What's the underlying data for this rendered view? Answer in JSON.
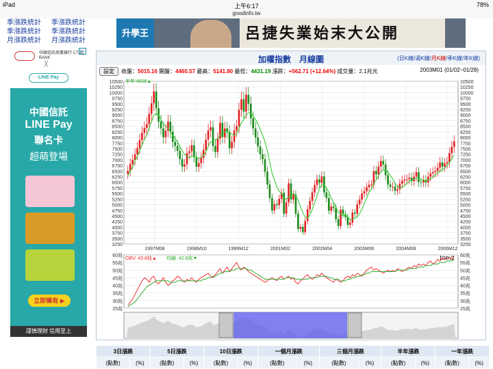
{
  "status": {
    "device": "iPad",
    "time": "上午6:17",
    "battery": "78%"
  },
  "url": "goodinfo.tw",
  "left_links": [
    "季漲跌統計",
    "季漲跌統計",
    "月漲跌統計",
    "月漲跌統計"
  ],
  "banner": {
    "logo": "升學王",
    "headline": "呂捷失業始末大公開"
  },
  "ad": {
    "bank": "中國信託商業銀行 CTBC BANK",
    "x": "╳",
    "linepay": "LINE Pay",
    "adchoice": "i▷",
    "line1": "中國信託",
    "line2": "LINE Pay",
    "line3": "聯名卡",
    "line4": "超萌登場",
    "cta": "立即擁有 ▶",
    "footer": "謹慎理財 信用至上"
  },
  "panel": {
    "title": "加權指數　月線圖",
    "periods": [
      "日K線",
      "週K線",
      "月K線",
      "季K線",
      "年K線"
    ],
    "settings_button": "設定",
    "quote": {
      "close_label": "收盤：",
      "close": "5015.16",
      "open_label": "開盤：",
      "open": "4460.57",
      "high_label": "最高：",
      "high": "5141.80",
      "low_label": "最低：",
      "low": "4431.19",
      "change_label": "漲跌：",
      "change": "+562.71 (+12.64%)",
      "volume_label": "成交量：",
      "volume": "2.1兆元",
      "period": "2003M01 (01/02~01/28)"
    }
  },
  "chart_data": [
    {
      "type": "line",
      "title": "加權指數 月線圖",
      "ma_label": "半年:4608▲",
      "ylim": [
        3250,
        10500
      ],
      "yticks": [
        3250,
        3500,
        3750,
        4000,
        4250,
        4500,
        4750,
        5000,
        5250,
        5500,
        5750,
        6000,
        6250,
        6500,
        6750,
        7000,
        7250,
        7500,
        7750,
        8000,
        8250,
        8500,
        8750,
        9000,
        9250,
        9500,
        9750,
        10000,
        10250,
        10500
      ],
      "xlabels": [
        "1997M08",
        "1998M10",
        "1999M12",
        "2001M02",
        "2002M04",
        "2003M06",
        "2004M08",
        "2006M12"
      ],
      "series": [
        {
          "name": "月線收盤",
          "color": "#22aa22",
          "values": [
            6500,
            6820,
            7000,
            7250,
            7520,
            7880,
            8200,
            8420,
            8600,
            9050,
            9520,
            10050,
            9300,
            8700,
            8400,
            8010,
            8300,
            8700,
            8250,
            7800,
            7620,
            7400,
            7030,
            6700,
            6800,
            7300,
            7380,
            7650,
            7120,
            6690,
            6850,
            7080,
            7450,
            7900,
            8310,
            8450,
            7620,
            7350,
            7950,
            8650,
            8010,
            8400,
            8250,
            7520,
            7800,
            8310,
            8500,
            9230,
            9700,
            9150,
            9900,
            9500,
            8850,
            8400,
            8000,
            7600,
            7250,
            7030,
            6470,
            5900,
            5300,
            4740,
            5030,
            4980,
            5260,
            5530,
            4600,
            5100,
            5950,
            5230,
            5450,
            4600,
            3920,
            4010,
            3780,
            4270,
            4800,
            5170,
            5550,
            5880,
            6130,
            5970,
            6260,
            5550,
            5300,
            4730,
            4920,
            4850,
            4350,
            4050,
            4780,
            4580,
            4450,
            4100,
            4200,
            4650,
            4600,
            5015,
            5230,
            5500,
            5600,
            5780,
            5890,
            5900,
            6500,
            6350,
            6700,
            6950,
            6800,
            6310,
            5900,
            5800,
            5800,
            5620,
            5680,
            5940,
            6070,
            6120,
            6130,
            6200,
            6050,
            6250,
            6450,
            6010,
            6000,
            6100,
            5990,
            6250,
            6400,
            6450,
            6500,
            6650,
            6880,
            6700,
            6840,
            6900,
            7300,
            7580,
            7820
          ]
        },
        {
          "name": "半年",
          "color": "#3c3",
          "values": [
            6300,
            6500,
            6700,
            6950,
            7150,
            7400,
            7650,
            7900,
            8100,
            8400,
            8700,
            9000,
            9050,
            9000,
            8800,
            8600,
            8500,
            8400,
            8250,
            8100,
            7950,
            7800,
            7600,
            7400,
            7250,
            7150,
            7100,
            7150,
            7150,
            7100,
            7080,
            7100,
            7200,
            7350,
            7600,
            7800,
            7850,
            7900,
            7950,
            8100,
            8150,
            8250,
            8250,
            8200,
            8150,
            8100,
            8150,
            8400,
            8650,
            8800,
            9000,
            9100,
            9100,
            8950,
            8800,
            8600,
            8350,
            8100,
            7800,
            7400,
            6900,
            6400,
            6100,
            5800,
            5600,
            5500,
            5300,
            5250,
            5350,
            5400,
            5500,
            5400,
            5200,
            4900,
            4650,
            4450,
            4400,
            4550,
            4800,
            5100,
            5400,
            5700,
            5900,
            5900,
            5750,
            5550,
            5300,
            5100,
            4900,
            4650,
            4600,
            4500,
            4550,
            4450,
            4350,
            4350,
            4400,
            4450,
            4600,
            4800,
            5050,
            5300,
            5550,
            5700,
            5950,
            6100,
            6300,
            6450,
            6550,
            6550,
            6450,
            6300,
            6150,
            5950,
            5800,
            5750,
            5780,
            5850,
            5950,
            6050,
            6100,
            6130,
            6200,
            6150,
            6100,
            6100,
            6080,
            6100,
            6150,
            6230,
            6320,
            6420,
            6500,
            6580,
            6650,
            6750,
            6880,
            7050,
            7200
          ]
        }
      ]
    },
    {
      "type": "line",
      "title": "OBV",
      "obv_label": "OBV: 43.8兆▲",
      "ma_label": "均線: 42.8兆▼",
      "legend": "【OBV】",
      "ylim": [
        25,
        60
      ],
      "yticks": [
        "60兆",
        "55兆",
        "50兆",
        "45兆",
        "40兆",
        "35兆",
        "30兆",
        "25兆"
      ],
      "series": [
        {
          "name": "OBV",
          "color": "#e33",
          "values": [
            27,
            29,
            31,
            34,
            37,
            40,
            43,
            45,
            44,
            42,
            45,
            46,
            42,
            41,
            43,
            45,
            42,
            40,
            41,
            43,
            44,
            46,
            45,
            43,
            42,
            44,
            43,
            45,
            43,
            42,
            44,
            45,
            46,
            47,
            48,
            46,
            45,
            47,
            49,
            51,
            48,
            50,
            52,
            49,
            51,
            53,
            55,
            52,
            50,
            52,
            51,
            49,
            48,
            47,
            46,
            45,
            44,
            43,
            42,
            43,
            44,
            45,
            44,
            43,
            45,
            46,
            44,
            45,
            46,
            44,
            45,
            42,
            41,
            43,
            44,
            46,
            47,
            45,
            44,
            45,
            47,
            46,
            48,
            46,
            45,
            44,
            43,
            42,
            44,
            43,
            42,
            43,
            45,
            46,
            45,
            47,
            46,
            48,
            47,
            46,
            48,
            50,
            51,
            52,
            50,
            51,
            50,
            49,
            48,
            49,
            50,
            49,
            50,
            49,
            51,
            50,
            49,
            50,
            51,
            52,
            51,
            53,
            52,
            54,
            53,
            54,
            53,
            55,
            56,
            54,
            55,
            57,
            56,
            58,
            57,
            58,
            58,
            57,
            59
          ]
        },
        {
          "name": "均線",
          "color": "#3a3",
          "values": [
            26,
            27,
            28,
            29,
            31,
            33,
            35,
            37,
            39,
            40,
            41,
            42,
            43,
            43,
            43,
            43,
            43,
            43,
            42,
            42,
            42,
            43,
            43,
            43,
            43,
            43,
            43,
            43,
            43,
            43,
            43,
            43,
            44,
            44,
            45,
            45,
            46,
            46,
            47,
            48,
            48,
            49,
            49,
            49,
            50,
            50,
            51,
            51,
            51,
            51,
            51,
            50,
            50,
            49,
            48,
            47,
            46,
            45,
            44,
            44,
            44,
            44,
            44,
            44,
            44,
            44,
            44,
            45,
            45,
            45,
            45,
            44,
            44,
            44,
            44,
            44,
            44,
            45,
            45,
            45,
            45,
            46,
            46,
            46,
            46,
            45,
            45,
            44,
            44,
            44,
            43,
            43,
            43,
            44,
            44,
            45,
            45,
            46,
            46,
            47,
            47,
            48,
            48,
            49,
            49,
            49,
            49,
            49,
            49,
            49,
            49,
            49,
            49,
            49,
            50,
            50,
            50,
            50,
            50,
            51,
            51,
            51,
            51,
            52,
            52,
            52,
            53,
            53,
            53,
            54,
            54,
            54,
            55,
            55,
            55,
            56,
            56,
            56,
            57
          ]
        }
      ]
    }
  ],
  "perf_table": {
    "headers": [
      "3日漲跌",
      "5日漲跌",
      "10日漲跌",
      "一個月漲跌",
      "三個月漲跌",
      "半年漲跌",
      "一年漲跌"
    ],
    "sub": [
      "(點數)",
      "(%)"
    ]
  }
}
